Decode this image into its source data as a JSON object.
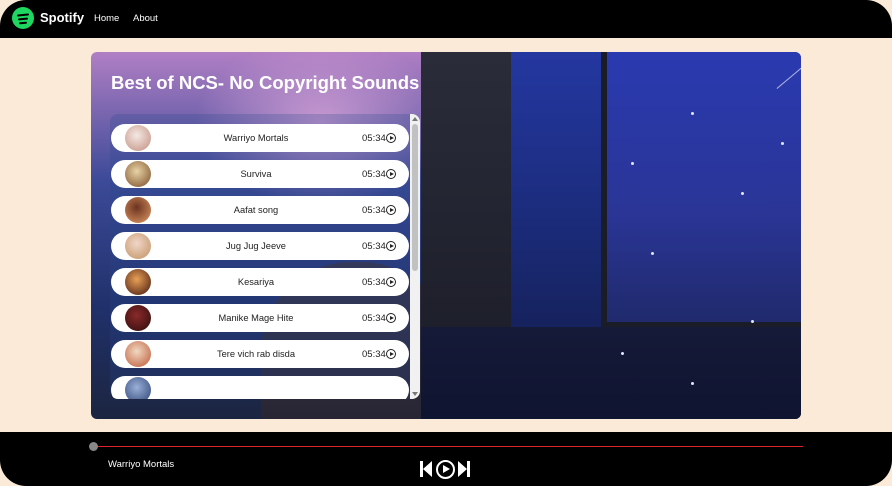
{
  "nav": {
    "brand": "Spotify",
    "links": [
      "Home",
      "About"
    ]
  },
  "playlist": {
    "title": "Best of NCS- No Copyright Sounds",
    "songs": [
      {
        "name": "Warriyo Mortals",
        "duration": "05:34",
        "thumb_colors": [
          "#f3e9e4",
          "#c99a8c"
        ]
      },
      {
        "name": "Surviva",
        "duration": "05:34",
        "thumb_colors": [
          "#e7d3a4",
          "#8a5f3a"
        ]
      },
      {
        "name": "Aafat song",
        "duration": "05:34",
        "thumb_colors": [
          "#6b3320",
          "#d08b5a"
        ]
      },
      {
        "name": "Jug Jug Jeeve",
        "duration": "05:34",
        "thumb_colors": [
          "#f1d6c8",
          "#c79b6f"
        ]
      },
      {
        "name": "Kesariya",
        "duration": "05:34",
        "thumb_colors": [
          "#e8a056",
          "#5a2a18"
        ]
      },
      {
        "name": "Manike Mage Hite",
        "duration": "05:34",
        "thumb_colors": [
          "#8a2a2a",
          "#3a1010"
        ]
      },
      {
        "name": "Tere vich rab disda",
        "duration": "05:34",
        "thumb_colors": [
          "#f0d8c0",
          "#c46a4a"
        ]
      },
      {
        "name": "",
        "duration": "",
        "thumb_colors": [
          "#9ab0d8",
          "#3a5080"
        ]
      }
    ]
  },
  "player": {
    "now_playing": "Warriyo Mortals",
    "progress": 0
  },
  "colors": {
    "accent_red": "#e0242b",
    "spotify_green": "#1ed760",
    "page_bg": "#fbead7"
  }
}
